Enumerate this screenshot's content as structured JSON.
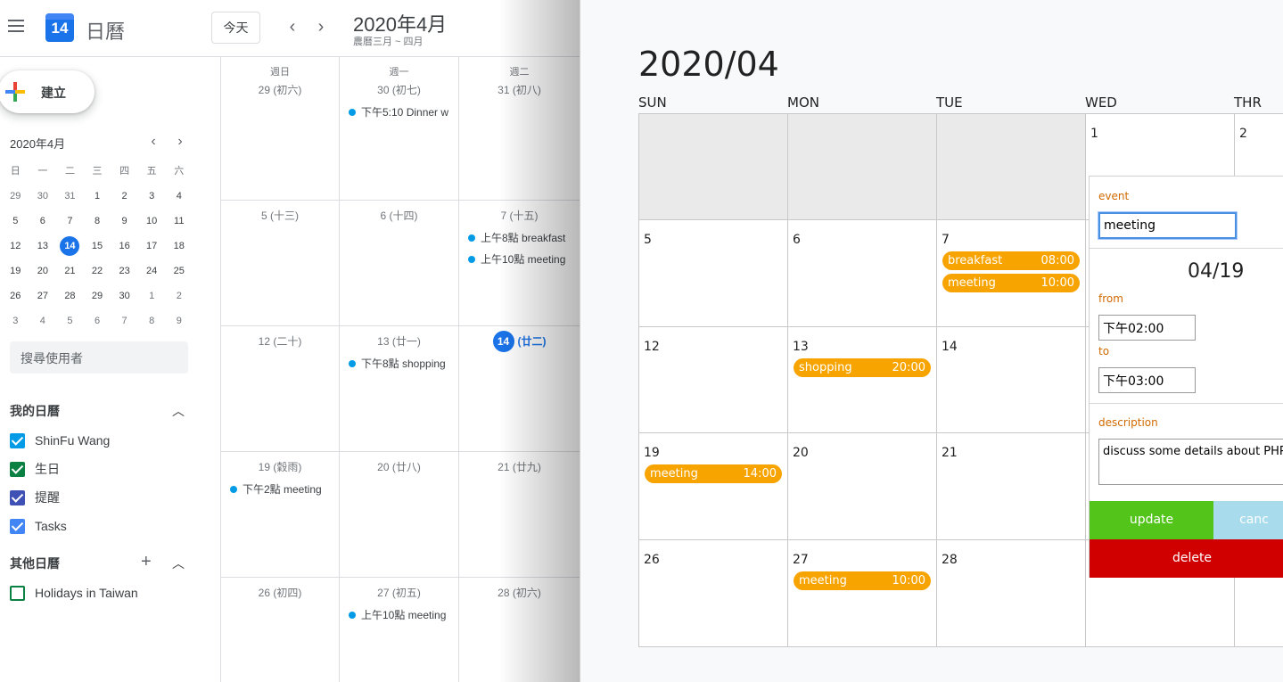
{
  "left": {
    "app_title": "日曆",
    "logo_day": "14",
    "today_button": "今天",
    "prev_arrow": "‹",
    "next_arrow": "›",
    "header_month": "2020年4月",
    "header_lunar": "農曆三月 ~ 四月",
    "create_label": "建立",
    "mini_calendar": {
      "title": "2020年4月",
      "dow": [
        "日",
        "一",
        "二",
        "三",
        "四",
        "五",
        "六"
      ],
      "weeks": [
        [
          "29",
          "30",
          "31",
          "1",
          "2",
          "3",
          "4"
        ],
        [
          "5",
          "6",
          "7",
          "8",
          "9",
          "10",
          "11"
        ],
        [
          "12",
          "13",
          "14",
          "15",
          "16",
          "17",
          "18"
        ],
        [
          "19",
          "20",
          "21",
          "22",
          "23",
          "24",
          "25"
        ],
        [
          "26",
          "27",
          "28",
          "29",
          "30",
          "1",
          "2"
        ],
        [
          "3",
          "4",
          "5",
          "6",
          "7",
          "8",
          "9"
        ]
      ],
      "today": "14"
    },
    "search_placeholder": "搜尋使用者",
    "my_calendars_title": "我的日曆",
    "my_calendars": [
      {
        "label": "ShinFu Wang",
        "color": "#039be5",
        "checked": true
      },
      {
        "label": "生日",
        "color": "#0b8043",
        "checked": true
      },
      {
        "label": "提醒",
        "color": "#3f51b5",
        "checked": true
      },
      {
        "label": "Tasks",
        "color": "#4285f4",
        "checked": true
      }
    ],
    "other_calendars_title": "其他日曆",
    "other_calendars": [
      {
        "label": "Holidays in Taiwan",
        "color": "#0b8043",
        "checked": false
      }
    ],
    "month_grid": {
      "columns": [
        {
          "dow": "週日"
        },
        {
          "dow": "週一"
        },
        {
          "dow": "週二"
        }
      ],
      "rows": [
        [
          {
            "date": "29 (初六)",
            "events": []
          },
          {
            "date": "30 (初七)",
            "events": [
              "下午5:10 Dinner w"
            ]
          },
          {
            "date": "31 (初八)",
            "events": []
          }
        ],
        [
          {
            "date": "5 (十三)",
            "events": []
          },
          {
            "date": "6 (十四)",
            "events": []
          },
          {
            "date": "7 (十五)",
            "events": [
              "上午8點 breakfast",
              "上午10點 meeting"
            ]
          }
        ],
        [
          {
            "date": "12 (二十)",
            "events": []
          },
          {
            "date": "13 (廿一)",
            "events": [
              "下午8點 shopping"
            ]
          },
          {
            "date": "14",
            "lunar": "(廿二)",
            "today": true,
            "events": []
          }
        ],
        [
          {
            "date": "19 (穀雨)",
            "events": [
              "下午2點 meeting"
            ]
          },
          {
            "date": "20 (廿八)",
            "events": []
          },
          {
            "date": "21 (廿九)",
            "events": []
          }
        ],
        [
          {
            "date": "26 (初四)",
            "events": []
          },
          {
            "date": "27 (初五)",
            "events": [
              "上午10點 meeting"
            ]
          },
          {
            "date": "28 (初六)",
            "events": []
          }
        ]
      ]
    }
  },
  "right": {
    "title": "2020/04",
    "dow": [
      "SUN",
      "MON",
      "TUE",
      "WED",
      "THR"
    ],
    "weeks": [
      [
        {
          "date": "",
          "empty": true
        },
        {
          "date": "",
          "empty": true
        },
        {
          "date": "",
          "empty": true
        },
        {
          "date": "1"
        },
        {
          "date": "2"
        }
      ],
      [
        {
          "date": "5"
        },
        {
          "date": "6"
        },
        {
          "date": "7",
          "events": [
            {
              "name": "breakfast",
              "time": "08:00"
            },
            {
              "name": "meeting",
              "time": "10:00"
            }
          ]
        },
        {
          "date": ""
        },
        {
          "date": ""
        }
      ],
      [
        {
          "date": "12"
        },
        {
          "date": "13",
          "events": [
            {
              "name": "shopping",
              "time": "20:00"
            }
          ]
        },
        {
          "date": "14"
        },
        {
          "date": ""
        },
        {
          "date": ""
        }
      ],
      [
        {
          "date": "19",
          "events": [
            {
              "name": "meeting",
              "time": "14:00"
            }
          ]
        },
        {
          "date": "20"
        },
        {
          "date": "21"
        },
        {
          "date": ""
        },
        {
          "date": ""
        }
      ],
      [
        {
          "date": "26"
        },
        {
          "date": "27",
          "events": [
            {
              "name": "meeting",
              "time": "10:00"
            }
          ]
        },
        {
          "date": "28"
        },
        {
          "date": ""
        },
        {
          "date": ""
        }
      ]
    ],
    "event_color": "#f7a400",
    "editor": {
      "event_label": "event",
      "event_value": "meeting",
      "date": "04/19",
      "from_label": "from",
      "from_value": "下午02:00",
      "to_label": "to",
      "to_value": "下午03:00",
      "description_label": "description",
      "description_value": "discuss some details about PHP",
      "update_label": "update",
      "cancel_label": "canc",
      "delete_label": "delete",
      "update_color": "#52c41a",
      "cancel_color": "#a8dcec",
      "delete_color": "#d10000"
    }
  }
}
